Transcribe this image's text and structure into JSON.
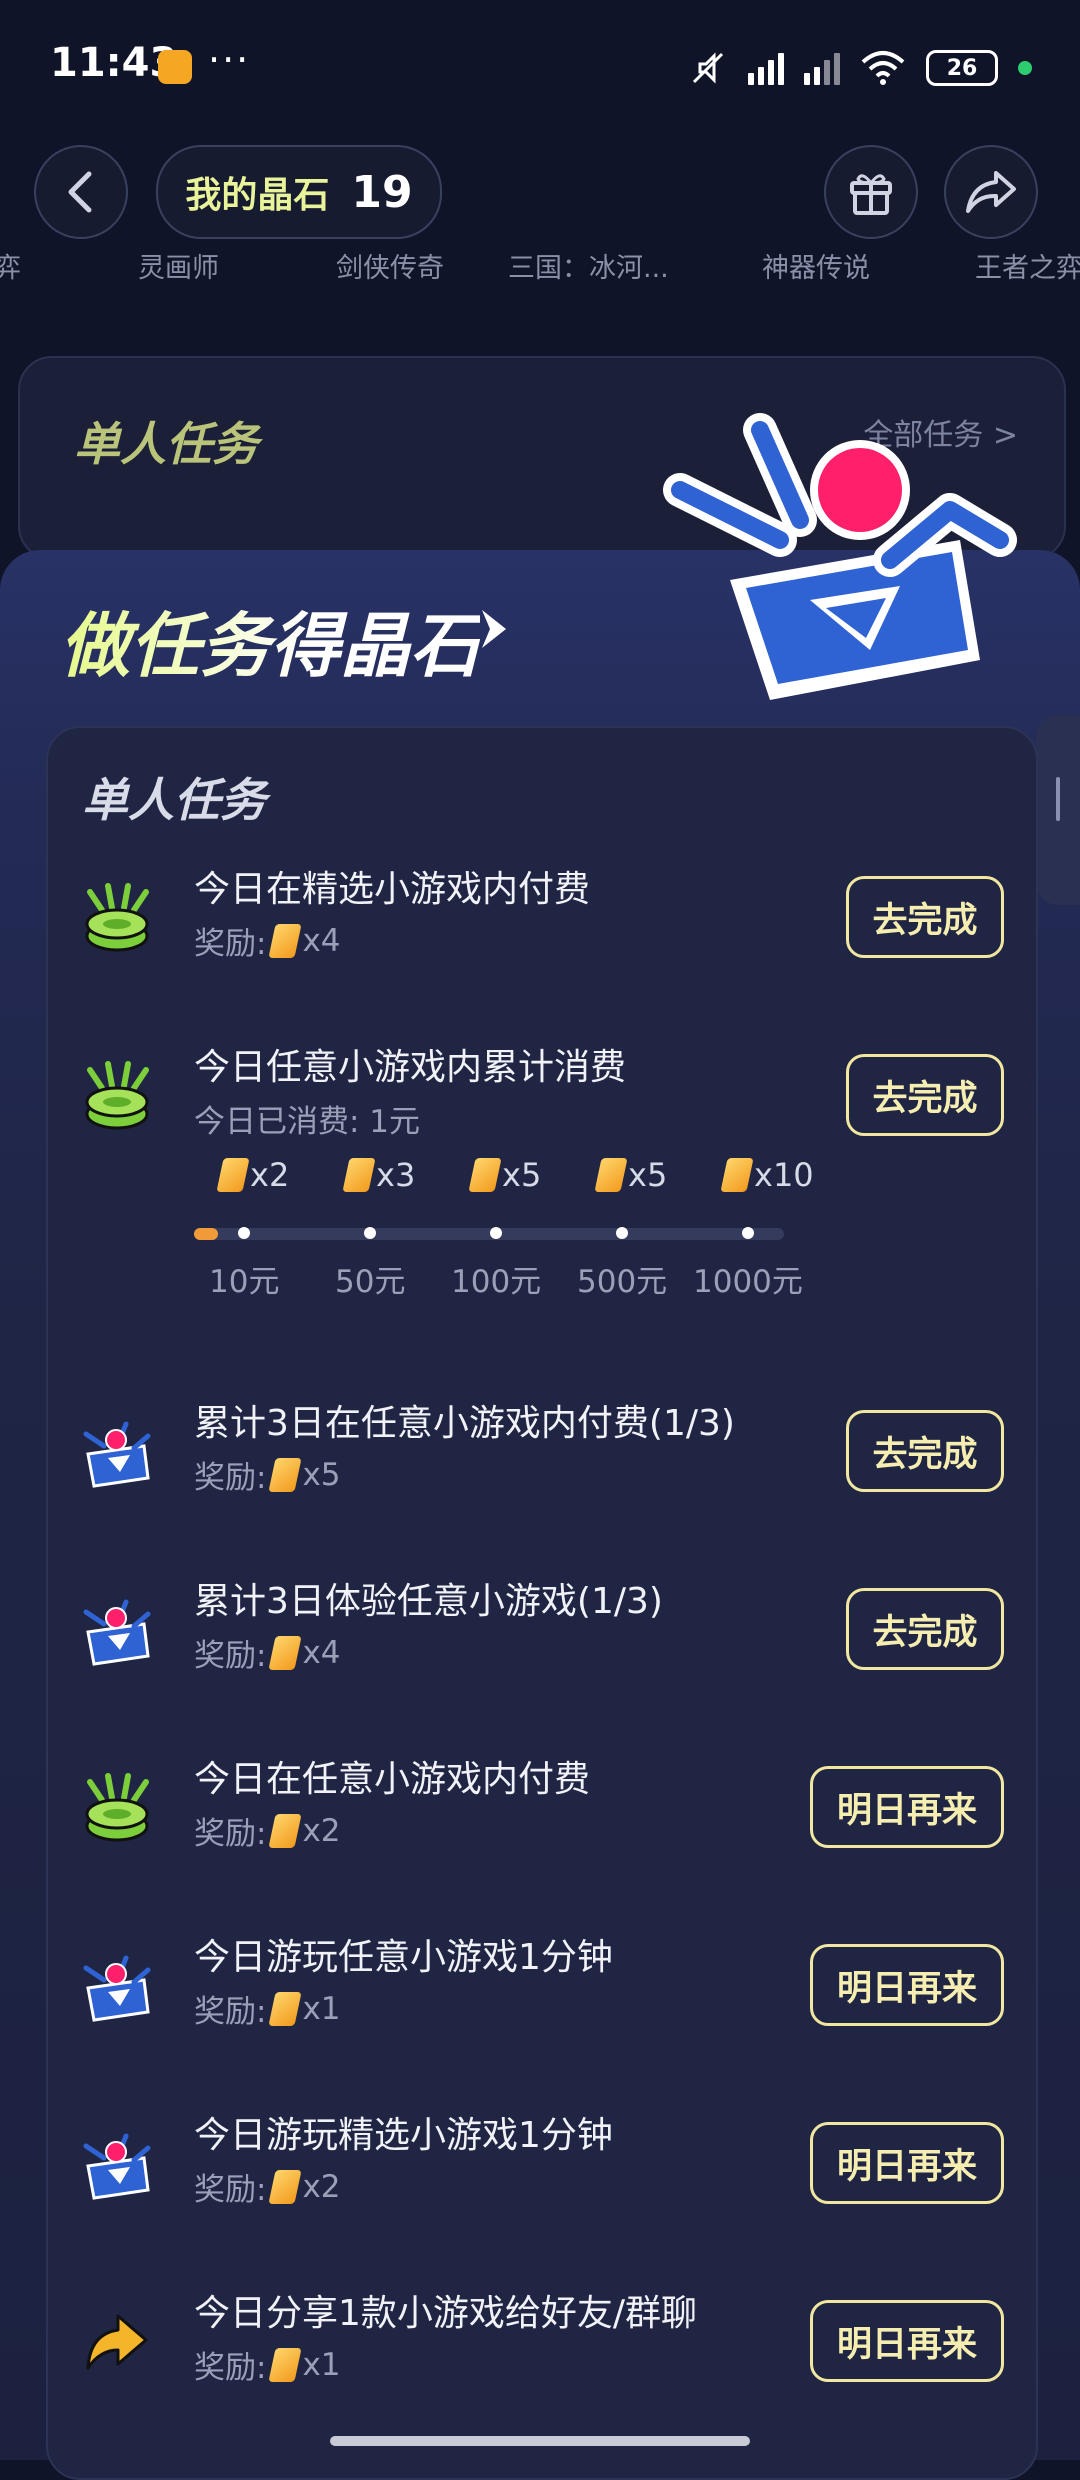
{
  "status_bar": {
    "time": "11:43",
    "more": "···",
    "battery": "26"
  },
  "header": {
    "crystal_label": "我的晶石",
    "crystal_count": "19"
  },
  "game_tabs": [
    "弈",
    "灵画师",
    "剑侠传奇",
    "三国：冰河...",
    "神器传说",
    "王者之弈"
  ],
  "bg_card": {
    "title": "单人任务",
    "all_tasks": "全部任务 >"
  },
  "panel": {
    "headline": "做任务得晶石",
    "section_title": "单人任务"
  },
  "tasks": [
    {
      "name": "今日在精选小游戏内付费",
      "sub": "奖励: ",
      "reward": "x4",
      "button": "去完成",
      "icon": "coin-stack-icon"
    },
    {
      "name": "今日任意小游戏内累计消费",
      "sub": "今日已消费: 1元",
      "button": "去完成",
      "icon": "coin-stack-icon",
      "progress": {
        "fill_fraction": 0.04,
        "steps": [
          {
            "reward": "x2",
            "label": "10元"
          },
          {
            "reward": "x3",
            "label": "50元"
          },
          {
            "reward": "x5",
            "label": "100元"
          },
          {
            "reward": "x5",
            "label": "500元"
          },
          {
            "reward": "x10",
            "label": "1000元"
          }
        ]
      }
    },
    {
      "name": "累计3日在任意小游戏内付费(1/3)",
      "sub": "奖励: ",
      "reward": "x5",
      "button": "去完成",
      "icon": "gift-box-icon"
    },
    {
      "name": "累计3日体验任意小游戏(1/3)",
      "sub": "奖励: ",
      "reward": "x4",
      "button": "去完成",
      "icon": "gift-box-icon"
    },
    {
      "name": "今日在任意小游戏内付费",
      "sub": "奖励: ",
      "reward": "x2",
      "button": "明日再来",
      "icon": "coin-stack-icon"
    },
    {
      "name": "今日游玩任意小游戏1分钟",
      "sub": "奖励: ",
      "reward": "x1",
      "button": "明日再来",
      "icon": "gift-box-icon"
    },
    {
      "name": "今日游玩精选小游戏1分钟",
      "sub": "奖励: ",
      "reward": "x2",
      "button": "明日再来",
      "icon": "gift-box-icon"
    },
    {
      "name": "今日分享1款小游戏给好友/群聊",
      "sub": "奖励: ",
      "reward": "x1",
      "button": "明日再来",
      "icon": "share-arrow-icon"
    }
  ],
  "colors": {
    "accent_button": "#f1e7a0",
    "background": "#0f1428",
    "panel": "#1f2543",
    "progress": "#f19a3a"
  }
}
